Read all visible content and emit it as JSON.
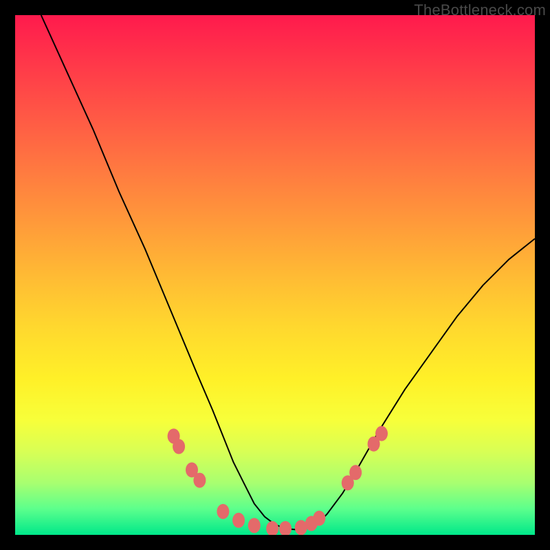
{
  "watermark": "TheBottleneck.com",
  "chart_data": {
    "type": "line",
    "title": "",
    "xlabel": "",
    "ylabel": "",
    "xlim": [
      0,
      100
    ],
    "ylim": [
      0,
      100
    ],
    "grid": false,
    "series": [
      {
        "name": "curve",
        "color": "#000000",
        "x": [
          5,
          10,
          15,
          20,
          25,
          30,
          35,
          38,
          40,
          42,
          44,
          46,
          48,
          50,
          52,
          54,
          56,
          58,
          60,
          63,
          66,
          70,
          75,
          80,
          85,
          90,
          95,
          100
        ],
        "y": [
          100,
          89,
          78,
          66,
          55,
          43,
          31,
          24,
          19,
          14,
          10,
          6,
          3.5,
          2,
          1.2,
          1,
          1.2,
          2,
          4,
          8,
          13,
          20,
          28,
          35,
          42,
          48,
          53,
          57
        ]
      }
    ],
    "markers": {
      "color": "#e46a6a",
      "points": [
        {
          "x": 30.5,
          "y": 19
        },
        {
          "x": 31.5,
          "y": 17
        },
        {
          "x": 34,
          "y": 12.5
        },
        {
          "x": 35.5,
          "y": 10.5
        },
        {
          "x": 40,
          "y": 4.5
        },
        {
          "x": 43,
          "y": 2.8
        },
        {
          "x": 46,
          "y": 1.8
        },
        {
          "x": 49.5,
          "y": 1.2
        },
        {
          "x": 52,
          "y": 1.2
        },
        {
          "x": 55,
          "y": 1.4
        },
        {
          "x": 57,
          "y": 2.2
        },
        {
          "x": 58.5,
          "y": 3.2
        },
        {
          "x": 64,
          "y": 10
        },
        {
          "x": 65.5,
          "y": 12
        },
        {
          "x": 69,
          "y": 17.5
        },
        {
          "x": 70.5,
          "y": 19.5
        }
      ]
    }
  }
}
